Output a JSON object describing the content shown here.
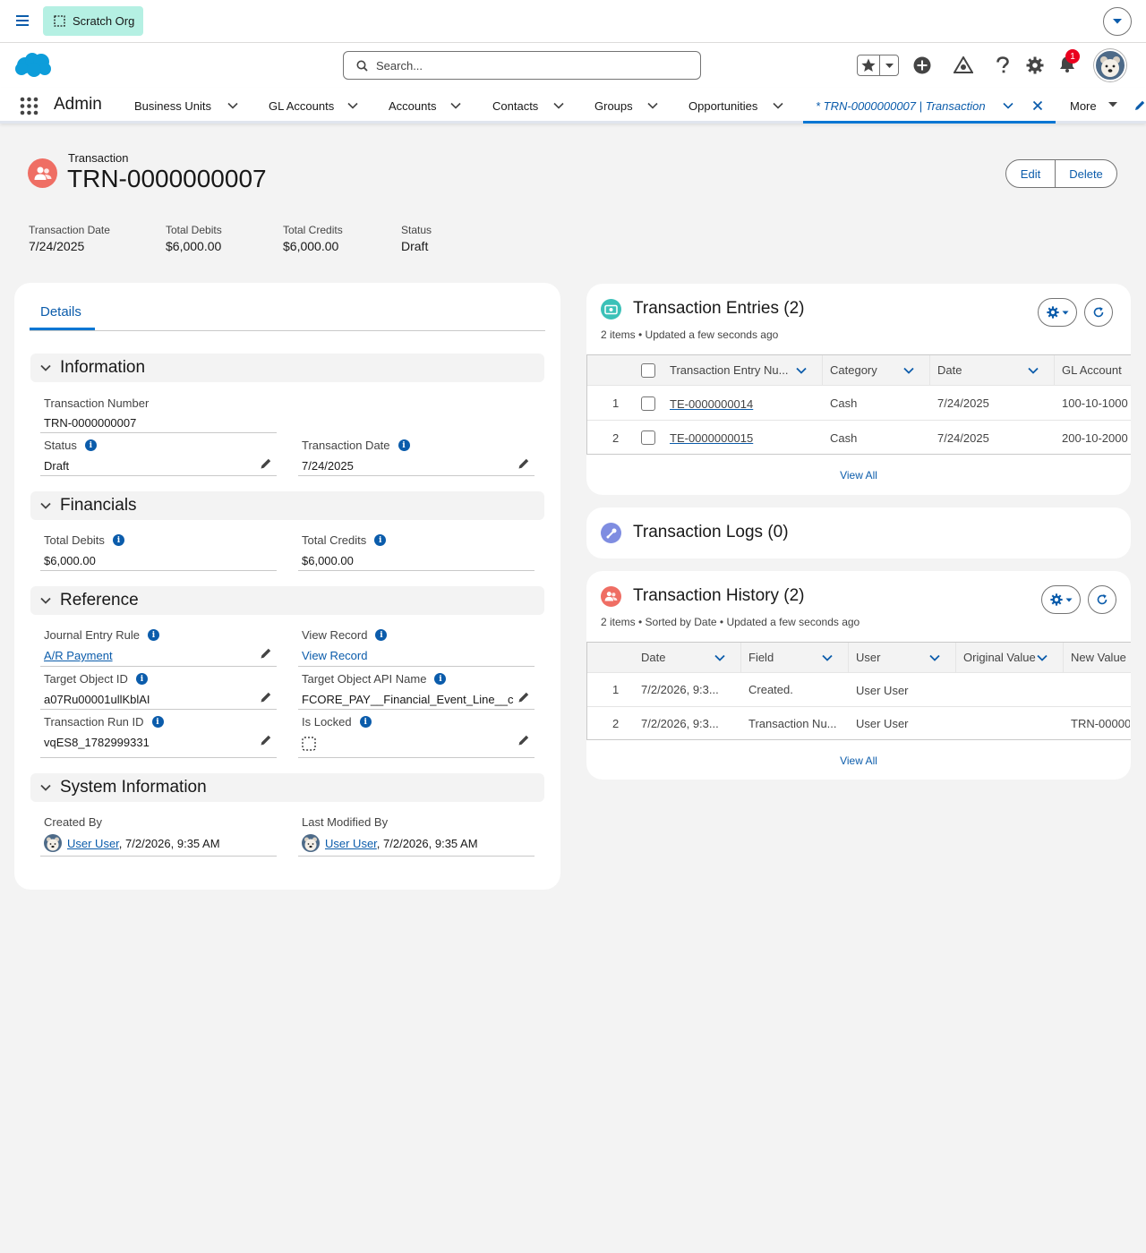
{
  "topbar": {
    "scratch_label": "Scratch Org"
  },
  "header": {
    "search_placeholder": "Search...",
    "notification_count": "1"
  },
  "nav": {
    "app_name": "Admin",
    "items": [
      "Business Units",
      "GL Accounts",
      "Accounts",
      "Contacts",
      "Groups",
      "Opportunities"
    ],
    "active_tab": "* TRN-0000000007 | Transaction",
    "more": "More"
  },
  "record": {
    "object_label": "Transaction",
    "name": "TRN-0000000007",
    "edit_label": "Edit",
    "delete_label": "Delete",
    "highlights": [
      {
        "label": "Transaction Date",
        "value": "7/24/2025"
      },
      {
        "label": "Total Debits",
        "value": "$6,000.00"
      },
      {
        "label": "Total Credits",
        "value": "$6,000.00"
      },
      {
        "label": "Status",
        "value": "Draft"
      }
    ]
  },
  "details": {
    "tab": "Details",
    "sections": {
      "information": "Information",
      "financials": "Financials",
      "reference": "Reference",
      "system": "System Information"
    },
    "fields": {
      "transaction_number": {
        "label": "Transaction Number",
        "value": "TRN-0000000007"
      },
      "status": {
        "label": "Status",
        "value": "Draft"
      },
      "transaction_date": {
        "label": "Transaction Date",
        "value": "7/24/2025"
      },
      "total_debits": {
        "label": "Total Debits",
        "value": "$6,000.00"
      },
      "total_credits": {
        "label": "Total Credits",
        "value": "$6,000.00"
      },
      "journal_entry_rule": {
        "label": "Journal Entry Rule",
        "value": "A/R Payment"
      },
      "view_record": {
        "label": "View Record",
        "value": "View Record"
      },
      "target_object_id": {
        "label": "Target Object ID",
        "value": "a07Ru00001ullKblAI"
      },
      "target_object_api": {
        "label": "Target Object API Name",
        "value": "FCORE_PAY__Financial_Event_Line__c"
      },
      "transaction_run_id": {
        "label": "Transaction Run ID",
        "value": "vqES8_1782999331"
      },
      "is_locked": {
        "label": "Is Locked"
      },
      "created_by": {
        "label": "Created By",
        "user": "User User",
        "date": ", 7/2/2026, 9:35 AM"
      },
      "last_modified_by": {
        "label": "Last Modified By",
        "user": "User User",
        "date": ", 7/2/2026, 9:35 AM"
      }
    }
  },
  "entries": {
    "title": "Transaction Entries (2)",
    "subtitle": "2 items • Updated a few seconds ago",
    "columns": [
      "Transaction Entry Nu...",
      "Category",
      "Date",
      "GL Account"
    ],
    "rows": [
      {
        "num": "1",
        "entry": "TE-0000000014",
        "category": "Cash",
        "date": "7/24/2025",
        "gl": "100-10-1000"
      },
      {
        "num": "2",
        "entry": "TE-0000000015",
        "category": "Cash",
        "date": "7/24/2025",
        "gl": "200-10-2000"
      }
    ],
    "view_all": "View All"
  },
  "logs": {
    "title": "Transaction Logs (0)"
  },
  "history": {
    "title": "Transaction History (2)",
    "subtitle": "2 items • Sorted by Date • Updated a few seconds ago",
    "columns": [
      "Date",
      "Field",
      "User",
      "Original Value",
      "New Value"
    ],
    "rows": [
      {
        "num": "1",
        "date": "7/2/2026, 9:3...",
        "field": "Created.",
        "user": "User User",
        "original": "",
        "new": ""
      },
      {
        "num": "2",
        "date": "7/2/2026, 9:3...",
        "field": "Transaction Nu...",
        "user": "User User",
        "original": "",
        "new": "TRN-00000"
      }
    ],
    "view_all": "View All"
  },
  "colors": {
    "brand": "#0176d3",
    "link": "#0b5cab",
    "scratch_bg": "#b5f0e3",
    "transaction_icon": "#ef6e64",
    "entries_icon": "#3bc1b8",
    "logs_icon": "#7f8de1",
    "notification": "#ea001e"
  }
}
